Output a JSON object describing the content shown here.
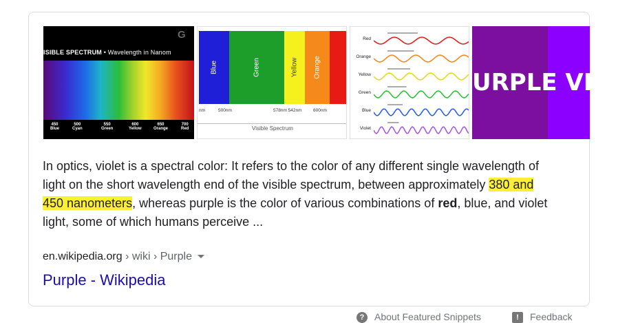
{
  "images": {
    "spectrum": {
      "title_bold": "ISIBLE SPECTRUM",
      "title_rest": " • Wavelength in Nanom",
      "logo_letter": "G",
      "ticks": [
        {
          "value": "450",
          "color": "Blue"
        },
        {
          "value": "500",
          "color": "Cyan"
        },
        {
          "value": "550",
          "color": "Green"
        },
        {
          "value": "600",
          "color": "Yellow"
        },
        {
          "value": "650",
          "color": "Orange"
        },
        {
          "value": "700",
          "color": "Red"
        }
      ]
    },
    "bars": {
      "colors": [
        {
          "label": "Blue",
          "hex": "#1f1fd8"
        },
        {
          "label": "Green",
          "hex": "#1d9e2a"
        },
        {
          "label": "Yellow",
          "hex": "#f5f01e"
        },
        {
          "label": "Orange",
          "hex": "#f58a1a"
        },
        {
          "label": "",
          "hex": "#e81b14"
        }
      ],
      "axis_labels": [
        "nm",
        "500nm",
        "578nm  542nm",
        "600nm"
      ],
      "caption": "Visible Spectrum"
    },
    "waves": {
      "rows": [
        {
          "label": "Red",
          "hex": "#e22121"
        },
        {
          "label": "Orange",
          "hex": "#f58a1a"
        },
        {
          "label": "Yellow",
          "hex": "#e8d81a"
        },
        {
          "label": "Green",
          "hex": "#2cc23a"
        },
        {
          "label": "Blue",
          "hex": "#2a62e8"
        },
        {
          "label": "Violet",
          "hex": "#a45ee0"
        }
      ]
    },
    "purple": {
      "text": "URPLE VIC"
    }
  },
  "snippet": {
    "part1": "In optics, violet is a spectral color: It refers to the color of any different single wavelength of light on the short wavelength end of the visible spectrum, between approximately ",
    "highlight": "380 and 450 nanometers",
    "part2": ", whereas purple is the color of various combinations of ",
    "bold": "red",
    "part3": ", blue, and violet light, some of which humans perceive ..."
  },
  "source": {
    "domain": "en.wikipedia.org",
    "path": " › wiki › Purple"
  },
  "result": {
    "title": "Purple - Wikipedia"
  },
  "footer": {
    "about_icon": "?",
    "about": "About Featured Snippets",
    "feedback_icon": "!",
    "feedback": "Feedback"
  },
  "colors": {
    "link": "#1a0dab",
    "highlight": "#fdef34"
  }
}
